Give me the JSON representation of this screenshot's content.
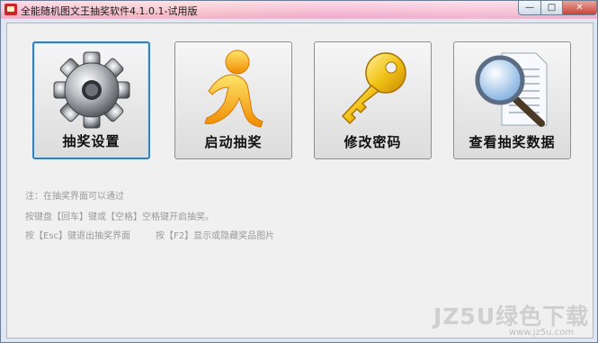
{
  "window": {
    "title": "全能随机图文王抽奖软件4.1.0.1-试用版",
    "controls": {
      "minimize": "—",
      "maximize": "□",
      "close": "✕"
    }
  },
  "buttons": [
    {
      "label": "抽奖设置",
      "icon": "gear-icon"
    },
    {
      "label": "启动抽奖",
      "icon": "running-man-icon"
    },
    {
      "label": "修改密码",
      "icon": "key-icon"
    },
    {
      "label": "查看抽奖数据",
      "icon": "magnifier-document-icon"
    }
  ],
  "notes": {
    "line1": "注：在抽奖界面可以通过",
    "line2": "按键盘【回车】键或【空格】空格键开启抽奖。",
    "line3a": "按【Esc】键退出抽奖界面",
    "line3b": "按【F2】显示或隐藏奖品图片"
  },
  "watermark": {
    "big": "JZ5U绿色下载",
    "small": "www.jz5u.com"
  },
  "colors": {
    "focus_border": "#3c7fb1",
    "close_button": "#c8453a",
    "note_text": "#9a9a9a"
  }
}
